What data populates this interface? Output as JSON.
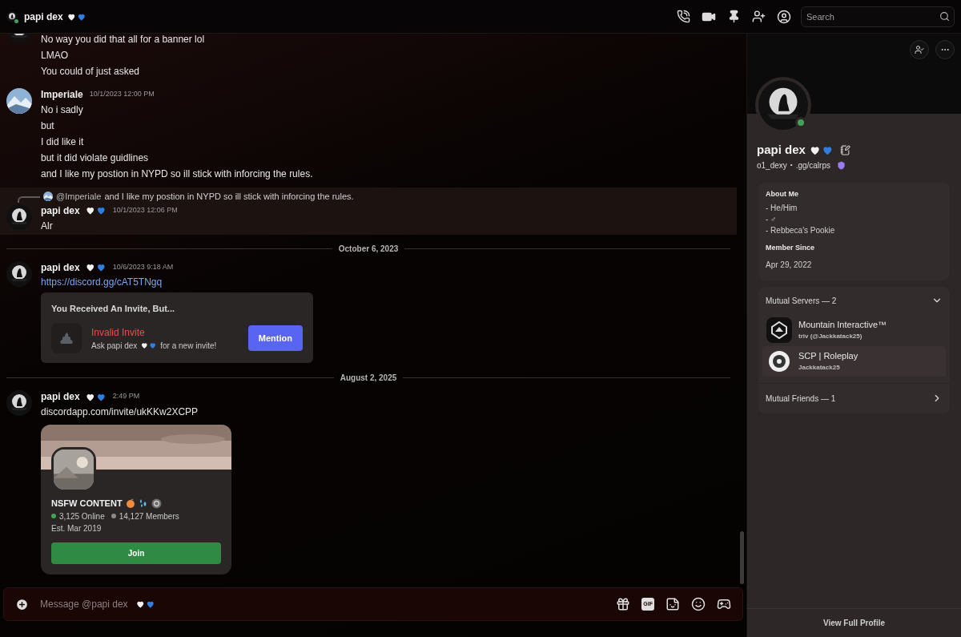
{
  "header": {
    "title": "papi dex",
    "search": {
      "placeholder": "Search"
    }
  },
  "feed": [
    {
      "kind": "message",
      "lines": [
        "No way you did that all for a banner lol",
        "LMAO",
        "You could of just asked"
      ]
    },
    {
      "kind": "message",
      "author": "Imperiale",
      "hearts": false,
      "time": "10/1/2023 12:00 PM",
      "lines": [
        "No i sadly",
        "but",
        "I did like it",
        "but it did violate guidlines",
        "and I like my postion in NYPD so ill stick with inforcing the rules."
      ]
    },
    {
      "kind": "message",
      "highlighted": true,
      "reply": {
        "mention": "@Imperiale",
        "text": "and I like my postion in NYPD so ill stick with inforcing the rules."
      },
      "author": "papi dex",
      "hearts": true,
      "time": "10/1/2023 12:06 PM",
      "lines": [
        "Alr"
      ]
    },
    {
      "kind": "divider",
      "label": "October 6, 2023"
    },
    {
      "kind": "message",
      "author": "papi dex",
      "hearts": true,
      "time": "10/6/2023 9:18 AM",
      "link": "https://discord.gg/cAT5TNgq",
      "invalid_invite": {
        "heading": "You Received An Invite, But...",
        "title": "Invalid Invite",
        "ask": "Ask papi dex",
        "tail": "for a new invite!",
        "button": "Mention"
      }
    },
    {
      "kind": "divider",
      "label": "August 2, 2025"
    },
    {
      "kind": "message",
      "author": "papi dex",
      "hearts": true,
      "time": "2:49 PM",
      "lines": [
        "discordapp.com/invite/ukKKw2XCPP"
      ],
      "server_invite": {
        "name": "NSFW CONTENT",
        "online": "3,125 Online",
        "members": "14,127 Members",
        "established": "Est. Mar 2019",
        "button": "Join"
      }
    }
  ],
  "composer": {
    "placeholder": "Message @papi dex",
    "gif_label": "GIF"
  },
  "profile": {
    "name": "papi dex",
    "username": "o1_dexy",
    "separator": "•",
    "tag": ".gg/calrps",
    "about_heading": "About Me",
    "about_lines": [
      "- He/Him",
      "- ♂",
      "- Rebbeca's Pookie"
    ],
    "member_since_heading": "Member Since",
    "member_since": "Apr 29, 2022",
    "mutual_servers": {
      "label": "Mutual Servers — 2",
      "expanded": true,
      "items": [
        {
          "name": "Mountain Interactive™",
          "nick": "triv (@Jackkatack25)",
          "selected": false
        },
        {
          "name": "SCP | Roleplay",
          "nick": "Jackkatack25",
          "selected": true
        }
      ]
    },
    "mutual_friends": {
      "label": "Mutual Friends — 1"
    },
    "view_full": "View Full Profile"
  }
}
